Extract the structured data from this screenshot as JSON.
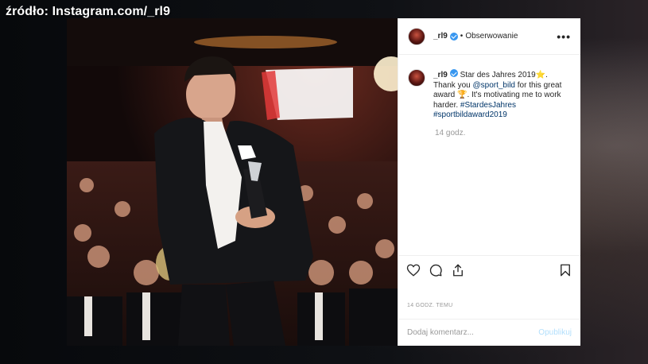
{
  "overlay": {
    "source": "źródło: Instagram.com/_rl9"
  },
  "post": {
    "username": "_rl9",
    "follow_label": "Obserwowanie",
    "separator": "•",
    "more_label": "•••",
    "caption": {
      "username": "_rl9",
      "text_1": " Star des Jahres 2019",
      "emoji_star": "⭐",
      "text_2": ". Thank you ",
      "mention": "@sport_bild",
      "text_3": " for this great award ",
      "emoji_trophy": "🏆",
      "text_4": ". It's motivating me to work harder. ",
      "hashtag_1": "#StardesJahres",
      "hashtag_2": "#sportbildaward2019"
    },
    "caption_age": "14 godz.",
    "post_age": "14 GODZ. TEMU",
    "comment": {
      "placeholder": "Dodaj komentarz...",
      "publish_label": "Opublikuj"
    },
    "icons": [
      "heart-icon",
      "comment-icon",
      "share-icon",
      "bookmark-icon"
    ]
  },
  "colors": {
    "link": "#003569",
    "verified": "#3897f0",
    "muted": "#999999",
    "publish": "#b2dffc"
  }
}
